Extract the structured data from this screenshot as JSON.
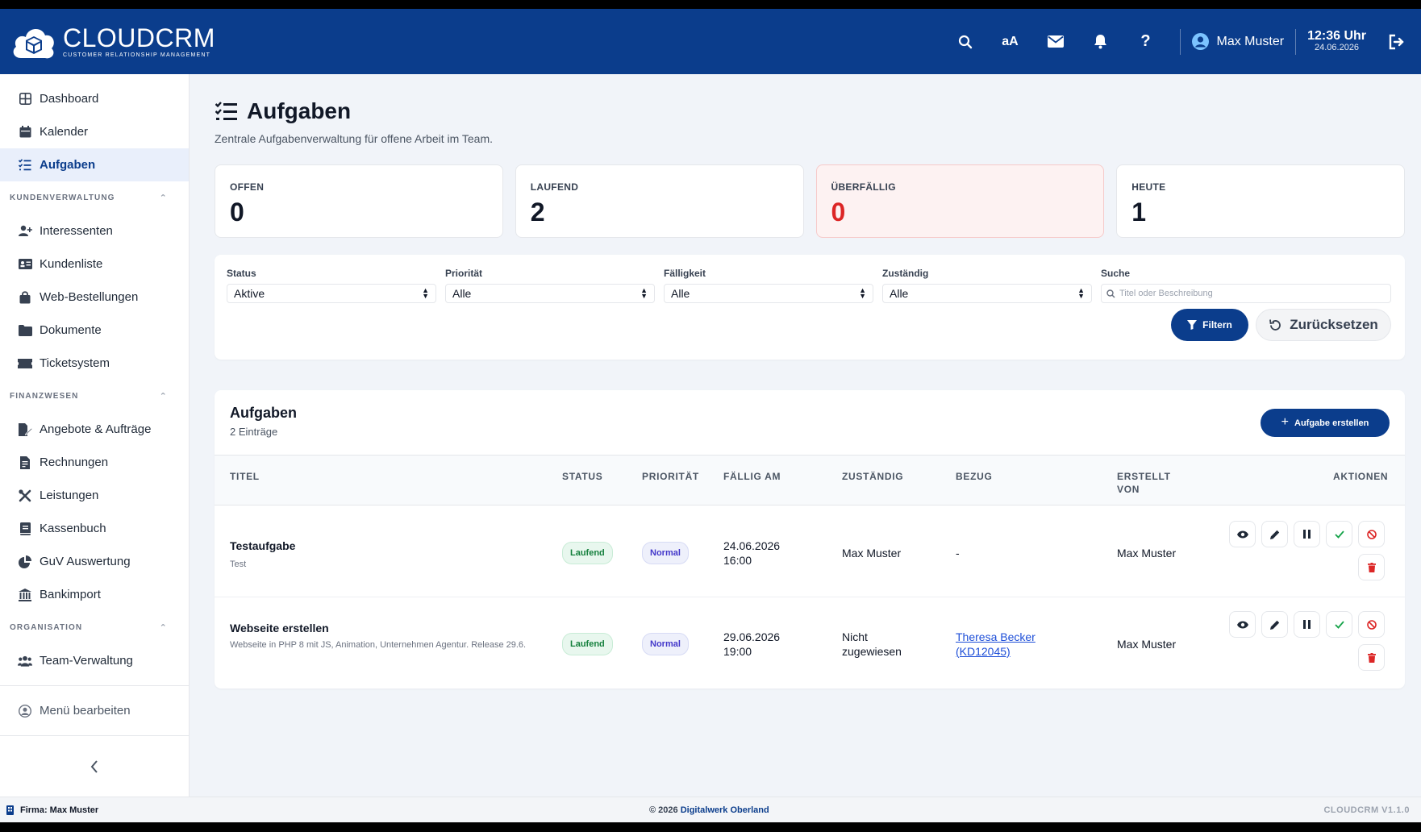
{
  "brand": {
    "name": "CLOUDCRM",
    "tagline": "CUSTOMER RELATIONSHIP MANAGEMENT"
  },
  "topbar": {
    "font_toggle": "aA",
    "user": "Max Muster",
    "time": "12:36 Uhr",
    "date": "24.06.2026"
  },
  "sidebar": {
    "top_items": [
      {
        "label": "Dashboard",
        "icon": "grid-icon"
      },
      {
        "label": "Kalender",
        "icon": "calendar-icon"
      },
      {
        "label": "Aufgaben",
        "icon": "task-list-icon",
        "active": true
      }
    ],
    "sections": [
      {
        "title": "KUNDENVERWALTUNG",
        "items": [
          "Interessenten",
          "Kundenliste",
          "Web-Bestellungen",
          "Dokumente",
          "Ticketsystem"
        ]
      },
      {
        "title": "FINANZWESEN",
        "items": [
          "Angebote & Aufträge",
          "Rechnungen",
          "Leistungen",
          "Kassenbuch",
          "GuV Auswertung",
          "Bankimport"
        ]
      },
      {
        "title": "ORGANISATION",
        "items": [
          "Team-Verwaltung"
        ]
      }
    ],
    "edit_menu": "Menü bearbeiten"
  },
  "page": {
    "title": "Aufgaben",
    "subtitle": "Zentrale Aufgabenverwaltung für offene Arbeit im Team."
  },
  "stats": [
    {
      "label": "OFFEN",
      "value": "0"
    },
    {
      "label": "LAUFEND",
      "value": "2"
    },
    {
      "label": "ÜBERFÄLLIG",
      "value": "0"
    },
    {
      "label": "HEUTE",
      "value": "1"
    }
  ],
  "filters": {
    "status": {
      "label": "Status",
      "value": "Aktive"
    },
    "prioritaet": {
      "label": "Priorität",
      "value": "Alle"
    },
    "faelligkeit": {
      "label": "Fälligkeit",
      "value": "Alle"
    },
    "zustaendig": {
      "label": "Zuständig",
      "value": "Alle"
    },
    "suche": {
      "label": "Suche",
      "placeholder": "Titel oder Beschreibung"
    },
    "filter_button": "Filtern",
    "reset_button": "Zurücksetzen"
  },
  "table": {
    "title": "Aufgaben",
    "count": "2 Einträge",
    "create_button": "Aufgabe erstellen",
    "columns": {
      "titel": "TITEL",
      "status": "STATUS",
      "prioritaet": "PRIORITÄT",
      "faellig": "FÄLLIG AM",
      "zustaendig": "ZUSTÄNDIG",
      "bezug": "BEZUG",
      "erstellt_1": "ERSTELLT",
      "erstellt_2": "VON",
      "aktionen": "AKTIONEN"
    },
    "rows": [
      {
        "title": "Testaufgabe",
        "desc": "Test",
        "status": "Laufend",
        "priority": "Normal",
        "due_date": "24.06.2026",
        "due_time": "16:00",
        "assignee": "Max Muster",
        "assignee_2": "",
        "ref_1": "-",
        "ref_2": "",
        "created_by": "Max Muster"
      },
      {
        "title": "Webseite erstellen",
        "desc": "Webseite in PHP 8 mit JS, Animation, Unternehmen Agentur. Release 29.6.",
        "status": "Laufend",
        "priority": "Normal",
        "due_date": "29.06.2026",
        "due_time": "19:00",
        "assignee": "Nicht",
        "assignee_2": "zugewiesen",
        "ref_1": "Theresa Becker",
        "ref_2": "(KD12045)",
        "created_by": "Max Muster"
      }
    ]
  },
  "footer": {
    "firm": "Firma: Max Muster",
    "copyright": "© 2026",
    "company": "Digitalwerk Oberland",
    "version": "CLOUDCRM V1.1.0"
  },
  "colors": {
    "primary": "#0b3d8c",
    "danger": "#dc2626",
    "success": "#15803d",
    "background": "#f1f4f9"
  }
}
